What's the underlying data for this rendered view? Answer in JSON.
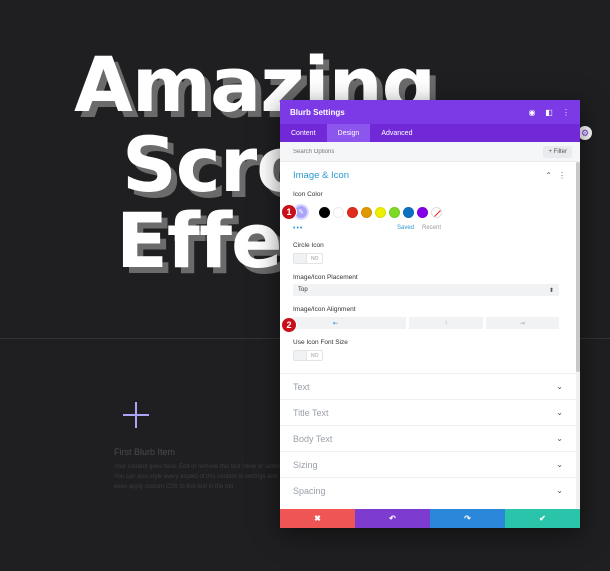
{
  "hero": {
    "line1": "Amazing",
    "line2": "Scro",
    "line3": "Effec"
  },
  "blurb": {
    "title": "First Blurb Item",
    "body": "Your content goes here. Edit or remove this text inline or settings. You can also style every aspect of this content in settings and even apply custom CSS to this text in the mo"
  },
  "modal": {
    "title": "Blurb Settings",
    "tabs": [
      {
        "label": "Content",
        "active": false
      },
      {
        "label": "Design",
        "active": true
      },
      {
        "label": "Advanced",
        "active": false
      }
    ],
    "search": {
      "placeholder": "Search Options",
      "filter_label": "+ Filter"
    },
    "section": {
      "title": "Image & Icon",
      "icon_color_label": "Icon Color",
      "swatch_colors": [
        "#000000",
        "#ffffff",
        "#e02b20",
        "#e09900",
        "#edf000",
        "#7cda24",
        "#0c71c3",
        "#8300e9"
      ],
      "picker_color": "#a9a4f8",
      "saved_label": "Saved",
      "recent_label": "Recent",
      "more_dots": "•••",
      "circle_icon_label": "Circle Icon",
      "circle_icon_value": "NO",
      "placement_label": "Image/Icon Placement",
      "placement_value": "Top",
      "alignment_label": "Image/Icon Alignment",
      "use_font_size_label": "Use Icon Font Size",
      "use_font_size_value": "NO"
    },
    "collapsed_sections": [
      "Text",
      "Title Text",
      "Body Text",
      "Sizing",
      "Spacing"
    ],
    "footer": {
      "cancel_color": "#ef5555",
      "undo_color": "#7e3bd0",
      "redo_color": "#2b87da",
      "save_color": "#29c4a9"
    }
  },
  "badges": {
    "one": "1",
    "two": "2"
  },
  "icons": {
    "close": "✖",
    "undo": "↶",
    "redo": "↷",
    "check": "✔"
  }
}
